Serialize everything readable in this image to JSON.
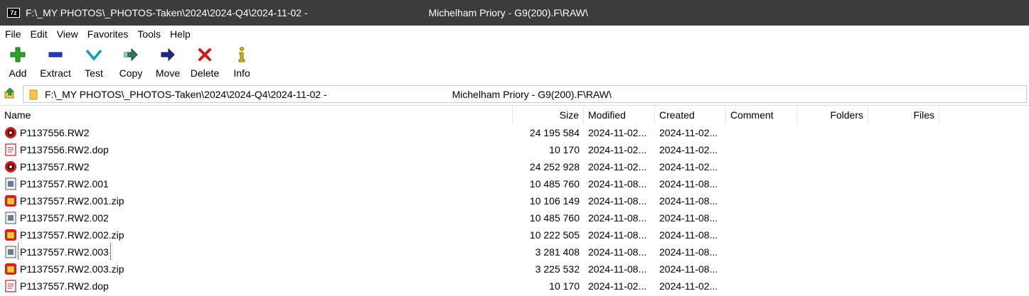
{
  "window": {
    "app_badge": "7z",
    "title_left": "F:\\_MY PHOTOS\\_PHOTOS-Taken\\2024\\2024-Q4\\2024-11-02 -",
    "title_right": "Michelham Priory - G9(200).F\\RAW\\"
  },
  "menu": [
    "File",
    "Edit",
    "View",
    "Favorites",
    "Tools",
    "Help"
  ],
  "toolbar": [
    {
      "label": "Add",
      "icon": "add-icon",
      "color": "#2aa52a"
    },
    {
      "label": "Extract",
      "icon": "extract-icon",
      "color": "#1f3fbf"
    },
    {
      "label": "Test",
      "icon": "test-icon",
      "color": "#2fb8c8"
    },
    {
      "label": "Copy",
      "icon": "copy-icon",
      "color": "#2a7a6a"
    },
    {
      "label": "Move",
      "icon": "move-icon",
      "color": "#1a2a8a"
    },
    {
      "label": "Delete",
      "icon": "delete-icon",
      "color": "#d01818"
    },
    {
      "label": "Info",
      "icon": "info-icon",
      "color": "#d8b000"
    }
  ],
  "address": {
    "path_left": "F:\\_MY PHOTOS\\_PHOTOS-Taken\\2024\\2024-Q4\\2024-11-02 -",
    "path_right": "Michelham Priory - G9(200).F\\RAW\\"
  },
  "columns": [
    "Name",
    "Size",
    "Modified",
    "Created",
    "Comment",
    "Folders",
    "Files"
  ],
  "files": [
    {
      "name": "P1137556.RW2",
      "size": "24 195 584",
      "modified": "2024-11-02...",
      "created": "2024-11-02...",
      "icon": "raw-image-icon"
    },
    {
      "name": "P1137556.RW2.dop",
      "size": "10 170",
      "modified": "2024-11-02...",
      "created": "2024-11-02...",
      "icon": "dop-file-icon"
    },
    {
      "name": "P1137557.RW2",
      "size": "24 252 928",
      "modified": "2024-11-02...",
      "created": "2024-11-02...",
      "icon": "raw-image-icon"
    },
    {
      "name": "P1137557.RW2.001",
      "size": "10 485 760",
      "modified": "2024-11-08...",
      "created": "2024-11-08...",
      "icon": "volume-file-icon"
    },
    {
      "name": "P1137557.RW2.001.zip",
      "size": "10 106 149",
      "modified": "2024-11-08...",
      "created": "2024-11-08...",
      "icon": "zip-archive-icon"
    },
    {
      "name": "P1137557.RW2.002",
      "size": "10 485 760",
      "modified": "2024-11-08...",
      "created": "2024-11-08...",
      "icon": "volume-file-icon"
    },
    {
      "name": "P1137557.RW2.002.zip",
      "size": "10 222 505",
      "modified": "2024-11-08...",
      "created": "2024-11-08...",
      "icon": "zip-archive-icon"
    },
    {
      "name": "P1137557.RW2.003",
      "size": "3 281 408",
      "modified": "2024-11-08...",
      "created": "2024-11-08...",
      "icon": "volume-file-icon",
      "focused": true
    },
    {
      "name": "P1137557.RW2.003.zip",
      "size": "3 225 532",
      "modified": "2024-11-08...",
      "created": "2024-11-08...",
      "icon": "zip-archive-icon"
    },
    {
      "name": "P1137557.RW2.dop",
      "size": "10 170",
      "modified": "2024-11-02...",
      "created": "2024-11-02...",
      "icon": "dop-file-icon"
    }
  ]
}
